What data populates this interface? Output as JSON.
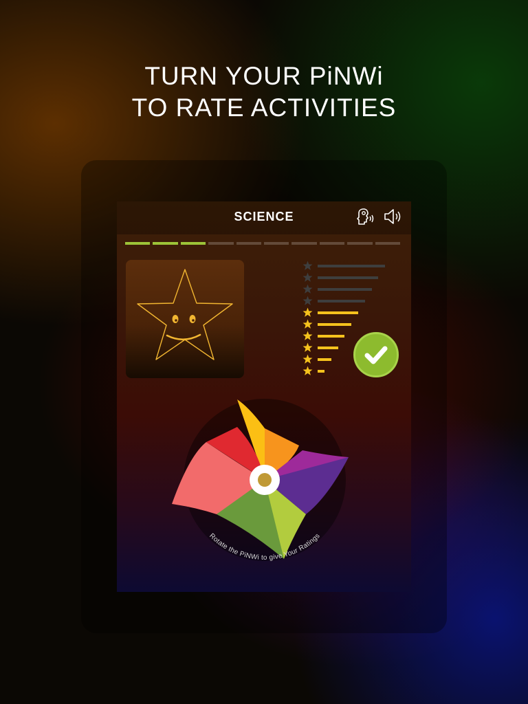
{
  "headline": {
    "line1": "TURN YOUR PiNWi",
    "line2": "TO RATE ACTIVITIES"
  },
  "screen": {
    "title": "SCIENCE",
    "icons": {
      "voice": "speech-head-icon",
      "sound": "speaker-icon"
    },
    "progress": {
      "total_steps": 10,
      "completed_steps": 3
    }
  },
  "rating": {
    "levels": 10,
    "selected": 6,
    "active_color": "#f5c21d",
    "inactive_color": "#3e3e3e"
  },
  "star_card": {
    "icon": "smiling-star-icon"
  },
  "submit": {
    "icon": "checkmark-icon",
    "color": "#8dbb2e"
  },
  "pinwheel": {
    "hint": "Rotate the PiNWi to give Your Ratings",
    "colors": [
      "#fbbf14",
      "#f7941d",
      "#9e2a9a",
      "#5c2d91",
      "#b2cc3e",
      "#6a9a3c",
      "#f26b6b",
      "#e02930"
    ]
  }
}
